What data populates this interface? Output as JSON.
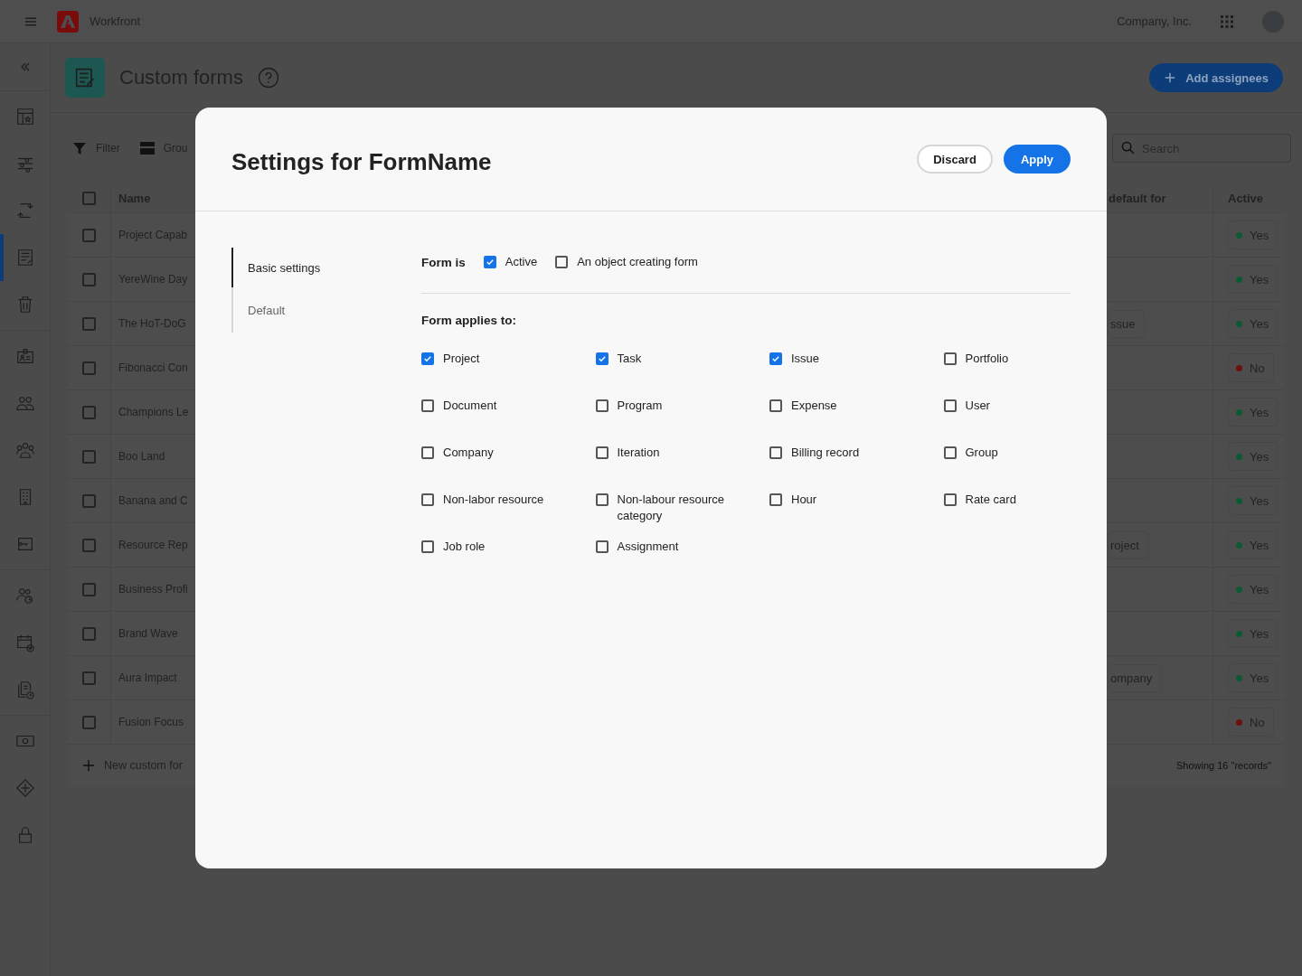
{
  "topbar": {
    "app_name": "Workfront",
    "org": "Company, Inc."
  },
  "sidebar": {
    "groups": [
      [
        {
          "selected": false
        },
        {
          "selected": false
        },
        {
          "selected": false
        },
        {
          "selected": true
        },
        {
          "selected": false
        }
      ],
      [
        {
          "selected": false
        },
        {
          "selected": false
        },
        {
          "selected": false
        },
        {
          "selected": false
        },
        {
          "selected": false
        }
      ],
      [
        {
          "selected": false
        },
        {
          "selected": false
        },
        {
          "selected": false
        }
      ],
      [
        {
          "selected": false
        },
        {
          "selected": false
        },
        {
          "selected": false
        }
      ]
    ]
  },
  "page": {
    "title": "Custom forms",
    "add_button": "Add assignees"
  },
  "toolbar": {
    "filter": "Filter",
    "group": "Grou",
    "search_placeholder": "Search"
  },
  "table": {
    "columns": [
      "Name",
      "default for",
      "Active"
    ],
    "header_checked": false,
    "rows": [
      {
        "name": "Project Capab",
        "checked": false,
        "active": "Yes",
        "color": "#0c5a31"
      },
      {
        "name": "YereWine Day",
        "checked": false,
        "active": "Yes",
        "color": "#0c5a31"
      },
      {
        "name": "The HoT-DoG",
        "checked": false,
        "default_for": "ssue",
        "active": "Yes",
        "color": "#0c5a31"
      },
      {
        "name": "Fibonacci Con",
        "checked": false,
        "active": "No",
        "color": "#6c1010"
      },
      {
        "name": "Champions Le",
        "checked": false,
        "active": "Yes",
        "color": "#0c5a31"
      },
      {
        "name": "Boo Land",
        "checked": false,
        "active": "Yes",
        "color": "#0c5a31"
      },
      {
        "name": "Banana and C",
        "checked": false,
        "active": "Yes",
        "color": "#0c5a31"
      },
      {
        "name": "Resource Rep",
        "checked": false,
        "default_for": "roject",
        "active": "Yes",
        "color": "#0c5a31"
      },
      {
        "name": "Business Profi",
        "checked": false,
        "active": "Yes",
        "color": "#0c5a31"
      },
      {
        "name": "Brand Wave",
        "checked": false,
        "active": "Yes",
        "color": "#0c5a31"
      },
      {
        "name": "Aura Impact",
        "checked": false,
        "default_for": "ompany",
        "active": "Yes",
        "color": "#0c5a31"
      },
      {
        "name": "Fusion Focus",
        "checked": false,
        "active": "No",
        "color": "#6c1010"
      }
    ],
    "add_row": "New custom for",
    "footer": "Showing 16 \"records\""
  },
  "modal": {
    "title": "Settings for FormName",
    "buttons": [
      {
        "label": "Discard",
        "kind": "secondary"
      },
      {
        "label": "Apply",
        "kind": "primary"
      }
    ],
    "nav": [
      {
        "label": "Basic settings",
        "selected": true
      },
      {
        "label": "Default",
        "selected": false
      }
    ],
    "form_is": {
      "label": "Form is",
      "options": [
        {
          "label": "Active",
          "checked": true
        },
        {
          "label": "An object creating form",
          "checked": false
        }
      ]
    },
    "applies": {
      "label": "Form applies to:",
      "options": [
        {
          "label": "Project",
          "checked": true
        },
        {
          "label": "Task",
          "checked": true
        },
        {
          "label": "Issue",
          "checked": true
        },
        {
          "label": "Portfolio",
          "checked": false
        },
        {
          "label": "Document",
          "checked": false
        },
        {
          "label": "Program",
          "checked": false
        },
        {
          "label": "Expense",
          "checked": false
        },
        {
          "label": "User",
          "checked": false
        },
        {
          "label": "Company",
          "checked": false
        },
        {
          "label": "Iteration",
          "checked": false
        },
        {
          "label": "Billing record",
          "checked": false
        },
        {
          "label": "Group",
          "checked": false
        },
        {
          "label": "Non-labor resource",
          "checked": false
        },
        {
          "label": "Non-labour resource category",
          "checked": false
        },
        {
          "label": "Hour",
          "checked": false
        },
        {
          "label": "Rate card",
          "checked": false
        },
        {
          "label": "Job role",
          "checked": false
        },
        {
          "label": "Assignment",
          "checked": false
        }
      ]
    }
  }
}
